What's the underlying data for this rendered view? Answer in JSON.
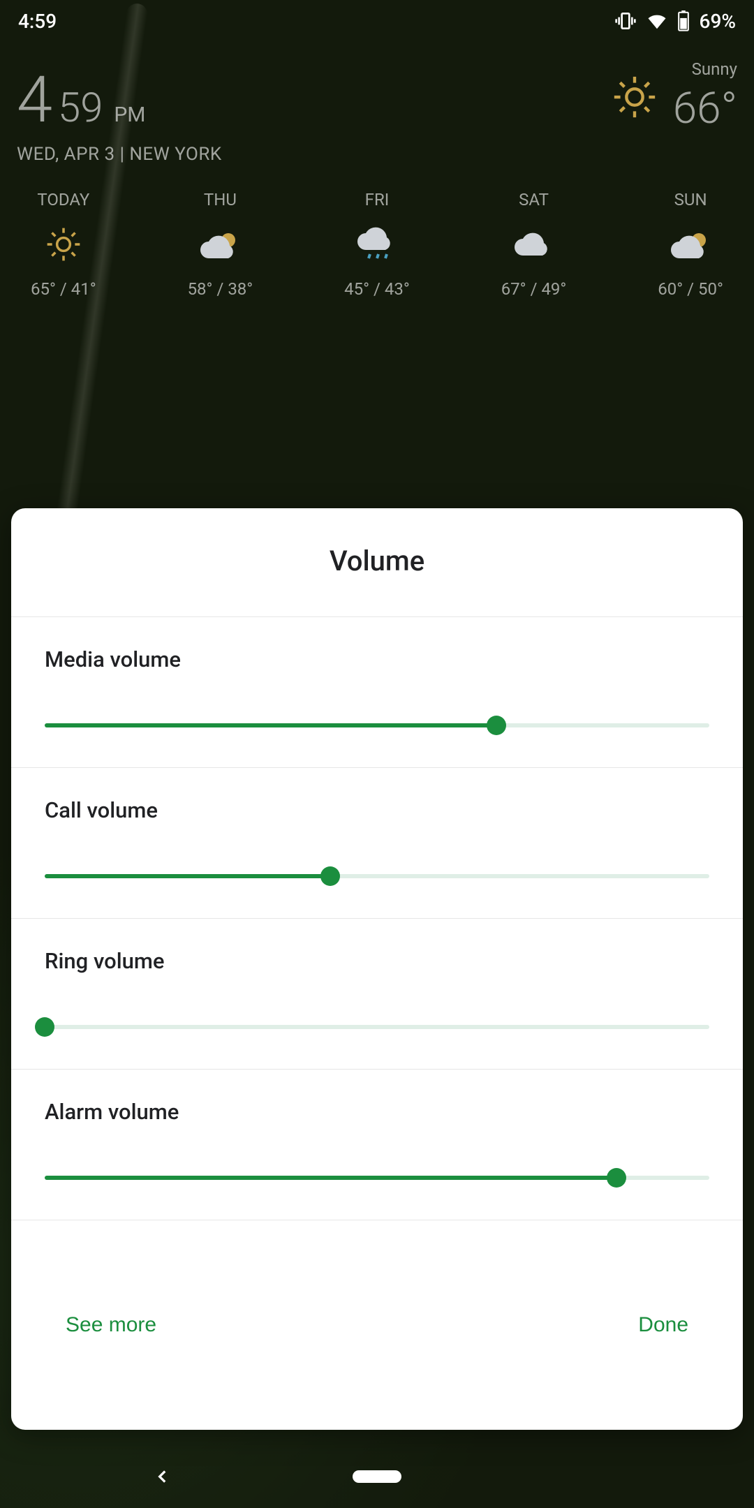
{
  "status": {
    "time": "4:59",
    "battery": "69%"
  },
  "home": {
    "hour": "4",
    "minute": "59",
    "ampm": "PM",
    "dateline": "WED, APR 3 | NEW YORK",
    "condition": "Sunny",
    "temp": "66°",
    "forecast": [
      {
        "label": "TODAY",
        "icon": "sun",
        "temps": "65° / 41°"
      },
      {
        "label": "THU",
        "icon": "partly-sunny",
        "temps": "58° / 38°"
      },
      {
        "label": "FRI",
        "icon": "rain",
        "temps": "45° / 43°"
      },
      {
        "label": "SAT",
        "icon": "cloud",
        "temps": "67° / 49°"
      },
      {
        "label": "SUN",
        "icon": "partly-sunny",
        "temps": "60° / 50°"
      }
    ]
  },
  "dialog": {
    "title": "Volume",
    "sliders": [
      {
        "label": "Media volume",
        "value": 68
      },
      {
        "label": "Call volume",
        "value": 43
      },
      {
        "label": "Ring volume",
        "value": 0
      },
      {
        "label": "Alarm volume",
        "value": 86
      }
    ],
    "see_more": "See more",
    "done": "Done"
  },
  "colors": {
    "accent": "#1b8e3e"
  }
}
